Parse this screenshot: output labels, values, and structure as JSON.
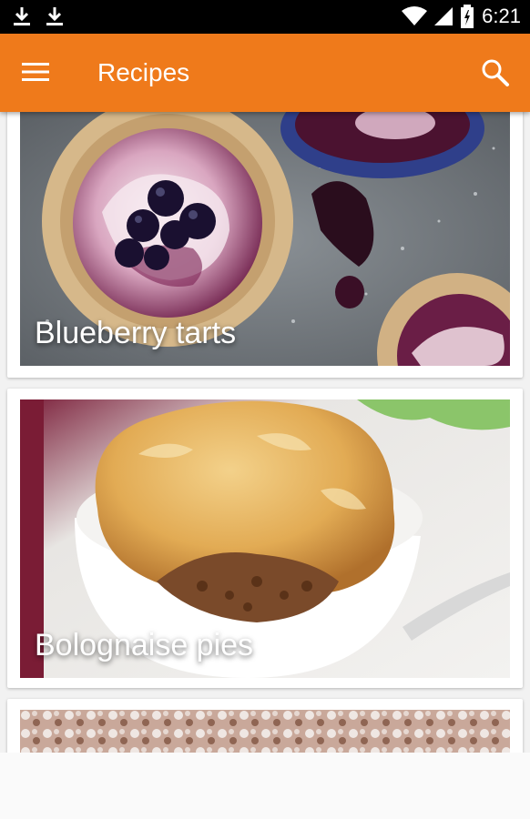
{
  "status_bar": {
    "time": "6:21",
    "icons": [
      "download-icon",
      "download-icon",
      "wifi-icon",
      "signal-icon",
      "battery-icon"
    ]
  },
  "app_bar": {
    "title": "Recipes",
    "menu_icon": "menu-icon",
    "search_icon": "search-icon",
    "color": "#ef7a1b"
  },
  "recipes": [
    {
      "title": "Blueberry tarts"
    },
    {
      "title": "Bolognaise pies"
    },
    {
      "title": ""
    }
  ]
}
